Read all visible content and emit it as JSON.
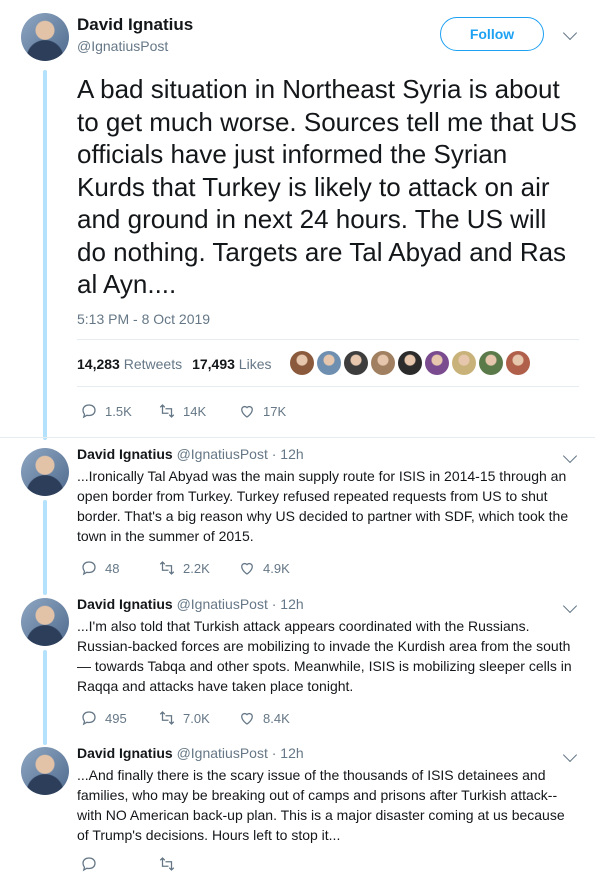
{
  "author": {
    "name": "David Ignatius",
    "handle": "@IgnatiusPost"
  },
  "follow_label": "Follow",
  "main_tweet": {
    "text": "A bad situation in Northeast Syria is about to get much worse. Sources tell me that US officials have just informed the Syrian Kurds that Turkey is likely to attack on air and ground in next 24 hours. The US will do nothing. Targets are Tal Abyad and Ras al Ayn....",
    "timestamp": "5:13 PM - 8 Oct 2019",
    "retweets": "14,283",
    "retweets_label": "Retweets",
    "likes": "17,493",
    "likes_label": "Likes",
    "actions": {
      "replies": "1.5K",
      "retweets": "14K",
      "likes": "17K"
    }
  },
  "replies": [
    {
      "name": "David Ignatius",
      "handle": "@IgnatiusPost",
      "time": "· 12h",
      "text": "...Ironically Tal Abyad was the main supply route for ISIS in 2014-15 through an open border from Turkey. Turkey refused repeated requests from US to shut border. That's a big reason why US decided to partner with SDF, which took the town in the summer of 2015.",
      "replies": "48",
      "retweets": "2.2K",
      "likes": "4.9K"
    },
    {
      "name": "David Ignatius",
      "handle": "@IgnatiusPost",
      "time": "· 12h",
      "text": "...I'm also told that Turkish attack appears coordinated with the Russians. Russian-backed forces are mobilizing to invade the Kurdish area from the south — towards Tabqa and other spots. Meanwhile, ISIS is mobilizing sleeper cells in Raqqa and attacks have taken place tonight.",
      "replies": "495",
      "retweets": "7.0K",
      "likes": "8.4K"
    },
    {
      "name": "David Ignatius",
      "handle": "@IgnatiusPost",
      "time": "· 12h",
      "text": "...And finally there is the scary issue of the thousands of ISIS detainees and families, who may be breaking out of camps and prisons after Turkish attack-- with NO American back-up plan. This is a major disaster coming at us because of Trump's decisions.  Hours left to stop it...",
      "replies": "",
      "retweets": "",
      "likes": ""
    }
  ],
  "liker_colors": [
    "#8b5a3c",
    "#6f8fb0",
    "#3d3d3d",
    "#a08060",
    "#2b2b2b",
    "#7a4c8f",
    "#c9b27a",
    "#5b7a4a",
    "#b0604a"
  ]
}
